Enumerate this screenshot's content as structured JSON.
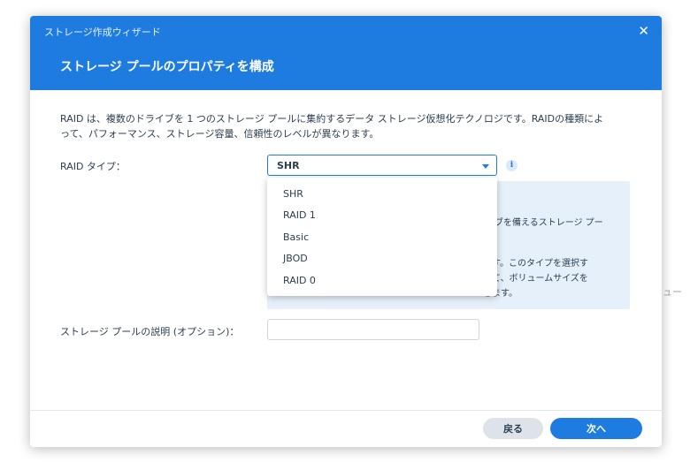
{
  "background": {
    "partial_text": "リュー"
  },
  "dialog": {
    "wizard_title": "ストレージ作成ウィザード",
    "close_symbol": "✕",
    "page_title": "ストレージ プールのプロパティを構成",
    "description_line1": "RAID は、複数のドライブを 1 つのストレージ プールに集約するデータ ストレージ仮想化テクノロジです。RAIDの種類によ",
    "description_line2": "って、パフォーマンス、ストレージ容量、信頼性のレベルが異なります。",
    "raid_type_label": "RAID タイプ：",
    "raid_type_selected": "SHR",
    "info_symbol": "i",
    "info_box_lines": [
      "ブを備えるストレージ プー",
      "ます。このタイプを選択す",
      "せて、ボリュームサイズを",
      "きます。"
    ],
    "dropdown_options": [
      "SHR",
      "RAID 1",
      "Basic",
      "JBOD",
      "RAID 0"
    ],
    "pool_description_label": "ストレージ プールの説明 (オプション)：",
    "pool_description_value": "",
    "back_button": "戻る",
    "next_button": "次へ"
  },
  "colors": {
    "accent": "#1e7ce0",
    "info_background": "#e6f0fb",
    "secondary_button": "#dde3e9"
  }
}
